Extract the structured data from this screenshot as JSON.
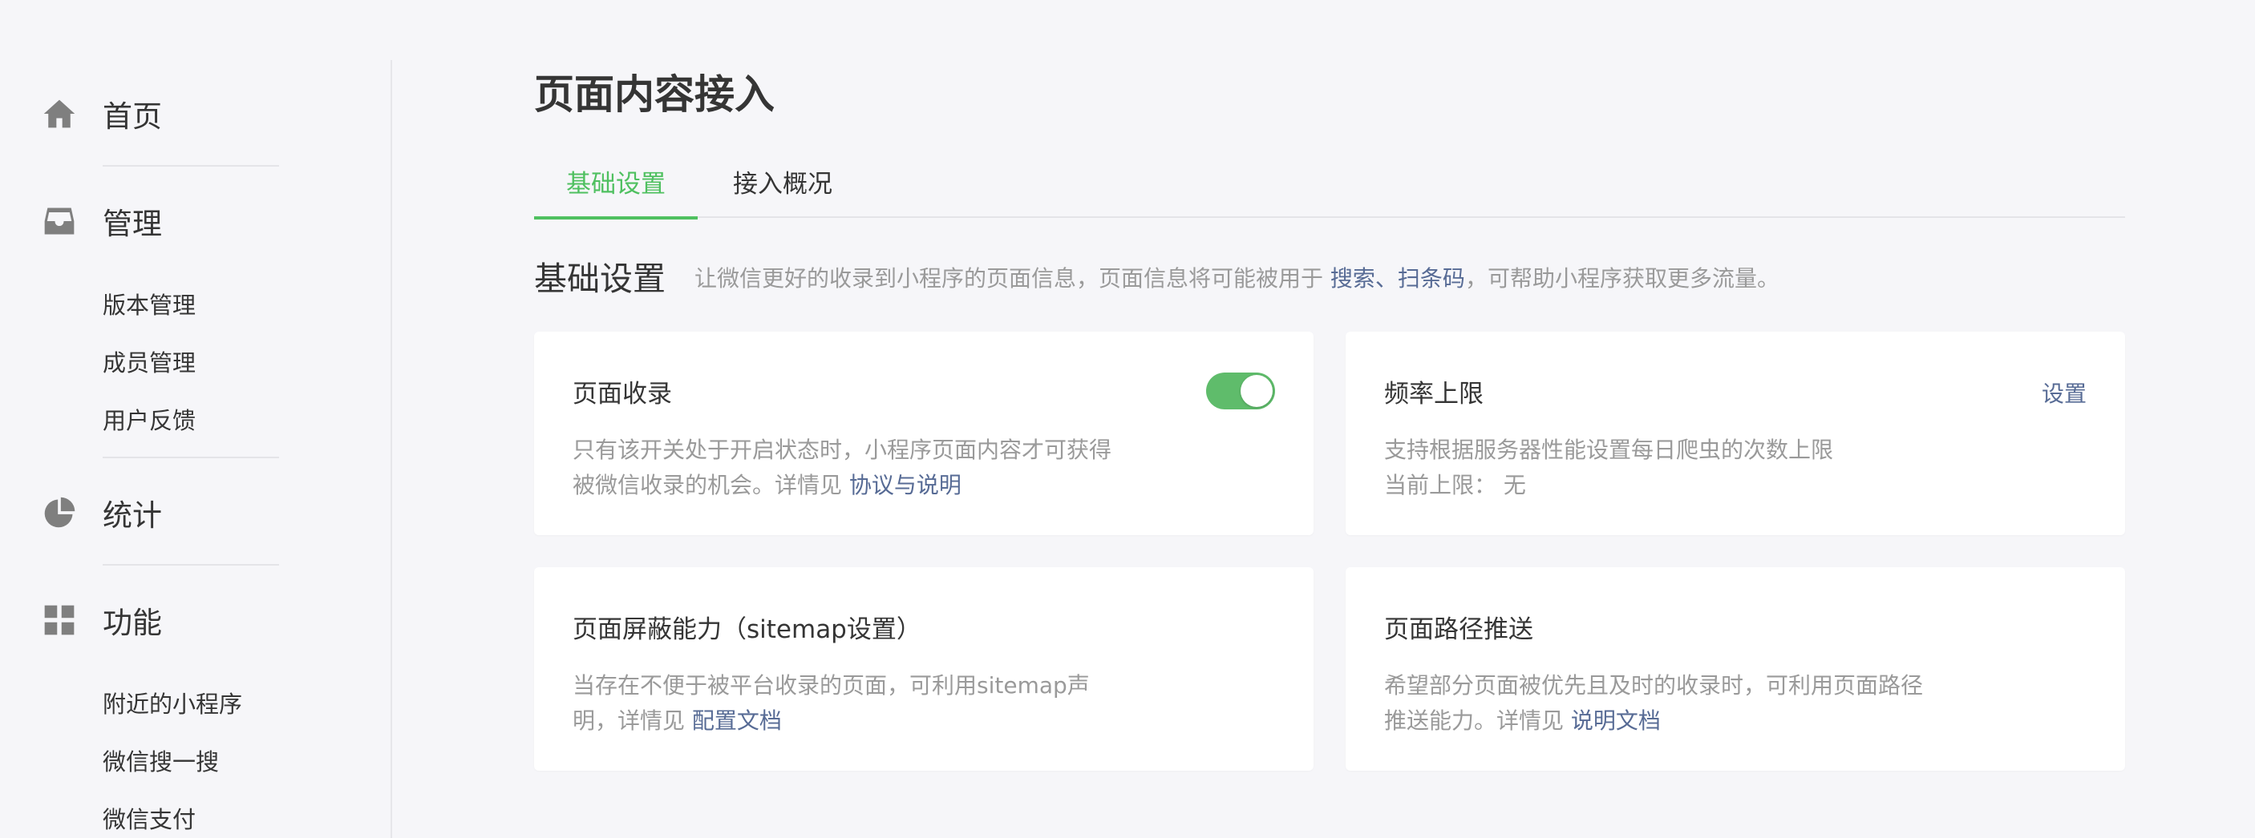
{
  "sidebar": {
    "home": {
      "label": "首页",
      "icon": "home-icon"
    },
    "manage": {
      "label": "管理",
      "icon": "inbox-icon",
      "items": [
        "版本管理",
        "成员管理",
        "用户反馈"
      ]
    },
    "stats": {
      "label": "统计",
      "icon": "pie-chart-icon"
    },
    "features": {
      "label": "功能",
      "icon": "grid-icon",
      "items": [
        "附近的小程序",
        "微信搜一搜",
        "微信支付"
      ]
    }
  },
  "main": {
    "title": "页面内容接入",
    "tabs": [
      {
        "label": "基础设置",
        "active": true
      },
      {
        "label": "接入概况",
        "active": false
      }
    ],
    "section": {
      "title": "基础设置",
      "desc_prefix": "让微信更好的收录到小程序的页面信息，页面信息将可能被用于",
      "desc_link": "搜索、扫条码",
      "desc_suffix": "，可帮助小程序获取更多流量。"
    },
    "cards": [
      {
        "title": "页面收录",
        "toggle_on": true,
        "desc_line1": "只有该开关处于开启状态时，小程序页面内容才可获得",
        "desc_line2": "被微信收录的机会。详情见",
        "link": "协议与说明"
      },
      {
        "title": "频率上限",
        "action": "设置",
        "desc_line1": "支持根据服务器性能设置每日爬虫的次数上限",
        "desc_line2": "当前上限：  无"
      },
      {
        "title": "页面屏蔽能力（sitemap设置）",
        "desc_line1": "当存在不便于被平台收录的页面，可利用sitemap声",
        "desc_line2": "明，详情见",
        "link": "配置文档"
      },
      {
        "title": "页面路径推送",
        "desc_line1": "希望部分页面被优先且及时的收录时，可利用页面路径",
        "desc_line2": "推送能力。详情见",
        "link": "说明文档"
      }
    ]
  },
  "colors": {
    "accent_green": "#4fc060",
    "link_blue": "#576b95",
    "muted_text": "#9a9a9a",
    "background": "#f6f6f9"
  }
}
